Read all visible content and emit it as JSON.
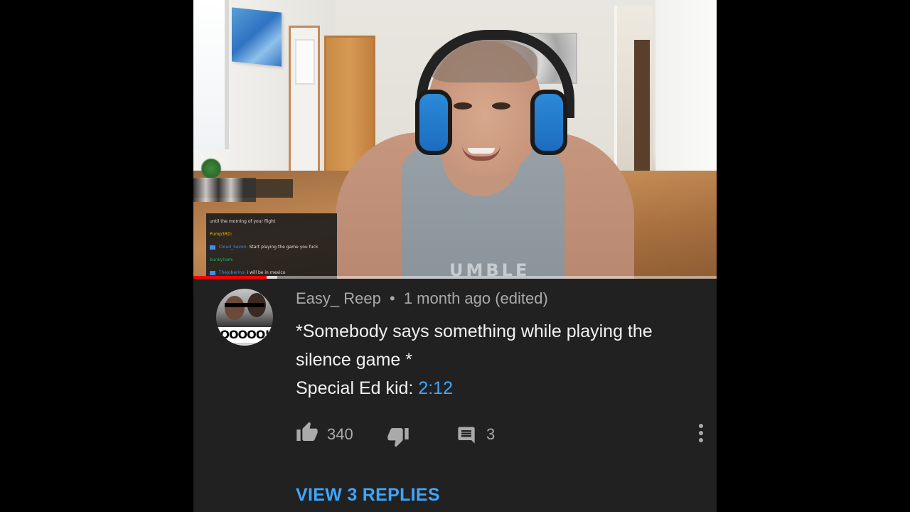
{
  "video": {
    "chat": {
      "lines": [
        {
          "user": "",
          "message": "until the morning of your flight"
        },
        {
          "user": "Pump3RD:",
          "message": ""
        },
        {
          "user": "Cloud_Seven:",
          "message": "Start playing the game you fuck"
        },
        {
          "user": "bunkyham:",
          "message": ""
        },
        {
          "user": "TheJoberino:",
          "message": "i will be in mexico"
        }
      ]
    },
    "tank_print": "UMBLE",
    "progress": {
      "played_fraction": 0.14,
      "buffered_fraction": 0.16
    },
    "colors": {
      "played": "#ff0000"
    }
  },
  "comment": {
    "author": "Easy_ Reep",
    "separator": "•",
    "posted": "1 month ago (edited)",
    "avatar_text": "OOOOO!",
    "text_lines": [
      "*Somebody says something while playing the",
      "silence game *"
    ],
    "text_prefix": "Special Ed kid: ",
    "timestamp_link": "2:12",
    "like_count": "340",
    "reply_count": "3",
    "view_replies_label": "VIEW 3 REPLIES",
    "icons": {
      "like": "thumbs-up-icon",
      "dislike": "thumbs-down-icon",
      "reply": "comment-icon",
      "more": "more-vert-icon"
    },
    "colors": {
      "link": "#3ea6ff",
      "text": "#f1f1f1",
      "muted": "#aaaaaa",
      "background": "#212121"
    }
  }
}
